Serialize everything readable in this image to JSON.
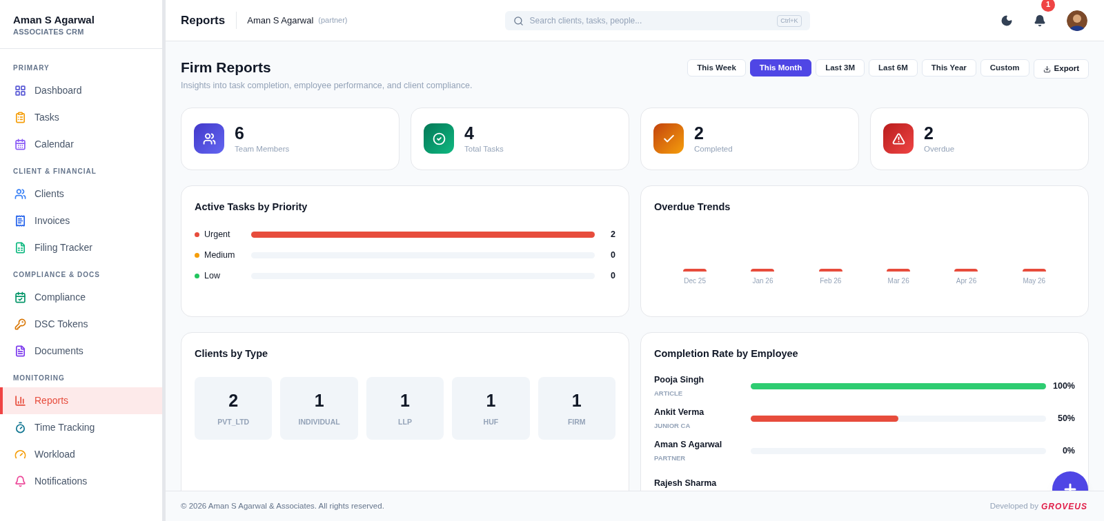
{
  "sidebar": {
    "brand": "Aman S Agarwal",
    "subtitle": "ASSOCIATES CRM",
    "sections": [
      {
        "title": "PRIMARY",
        "items": [
          {
            "label": "Dashboard",
            "selected": false
          },
          {
            "label": "Tasks",
            "selected": false
          },
          {
            "label": "Calendar",
            "selected": false
          }
        ]
      },
      {
        "title": "CLIENT & FINANCIAL",
        "items": [
          {
            "label": "Clients",
            "selected": false
          },
          {
            "label": "Invoices",
            "selected": false
          },
          {
            "label": "Filing Tracker",
            "selected": false
          }
        ]
      },
      {
        "title": "COMPLIANCE & DOCS",
        "items": [
          {
            "label": "Compliance",
            "selected": false
          },
          {
            "label": "DSC Tokens",
            "selected": false
          },
          {
            "label": "Documents",
            "selected": false
          }
        ]
      },
      {
        "title": "MONITORING",
        "items": [
          {
            "label": "Reports",
            "selected": true
          },
          {
            "label": "Time Tracking",
            "selected": false
          },
          {
            "label": "Workload",
            "selected": false
          },
          {
            "label": "Notifications",
            "selected": false
          }
        ]
      }
    ]
  },
  "header": {
    "page": "Reports",
    "user": "Aman S Agarwal",
    "role": "(partner)",
    "search": {
      "placeholder": "Search clients, tasks, people...",
      "shortcut": "Ctrl+K"
    },
    "notification_count": "1"
  },
  "page": {
    "title": "Firm Reports",
    "subtitle": "Insights into task completion, employee performance, and client compliance.",
    "periods": [
      {
        "label": "This Week",
        "selected": false
      },
      {
        "label": "This Month",
        "selected": true
      },
      {
        "label": "Last 3M",
        "selected": false
      },
      {
        "label": "Last 6M",
        "selected": false
      },
      {
        "label": "This Year",
        "selected": false
      },
      {
        "label": "Custom",
        "selected": false
      }
    ],
    "export": "Export"
  },
  "stats": [
    {
      "value": "6",
      "label": "Team Members"
    },
    {
      "value": "4",
      "label": "Total Tasks"
    },
    {
      "value": "2",
      "label": "Completed"
    },
    {
      "value": "2",
      "label": "Overdue"
    }
  ],
  "priority": {
    "title": "Active Tasks by Priority",
    "rows": [
      {
        "label": "Urgent",
        "color": "#e74c3c",
        "level": 1,
        "count": "2"
      },
      {
        "label": "Medium",
        "color": "#f59e0b",
        "level": 0,
        "count": "0"
      },
      {
        "label": "Low",
        "color": "#22c55e",
        "level": 0,
        "count": "0"
      }
    ]
  },
  "overdue_trends": {
    "title": "Overdue Trends",
    "months": [
      "Dec 25",
      "Jan 26",
      "Feb 26",
      "Mar 26",
      "Apr 26",
      "May 26"
    ]
  },
  "clients_by_type": {
    "title": "Clients by Type",
    "types": [
      {
        "value": "2",
        "label": "PVT_LTD"
      },
      {
        "value": "1",
        "label": "INDIVIDUAL"
      },
      {
        "value": "1",
        "label": "LLP"
      },
      {
        "value": "1",
        "label": "HUF"
      },
      {
        "value": "1",
        "label": "FIRM"
      }
    ]
  },
  "completion": {
    "title": "Completion Rate by Employee",
    "rows": [
      {
        "name": "Pooja Singh",
        "role": "ARTICLE",
        "level": 1,
        "color": "#2ecc71",
        "percent": "100%"
      },
      {
        "name": "Ankit Verma",
        "role": "JUNIOR CA",
        "level": 0.5,
        "color": "#e74c3c",
        "percent": "50%"
      },
      {
        "name": "Aman S Agarwal",
        "role": "PARTNER",
        "level": 0,
        "percent": "0%"
      },
      {
        "name": "Rajesh Sharma"
      }
    ]
  },
  "footer": {
    "copyright": "© 2026 Aman S Agarwal & Associates. All rights reserved.",
    "developed_by": "Developed by",
    "brand": "GROVEUS"
  }
}
